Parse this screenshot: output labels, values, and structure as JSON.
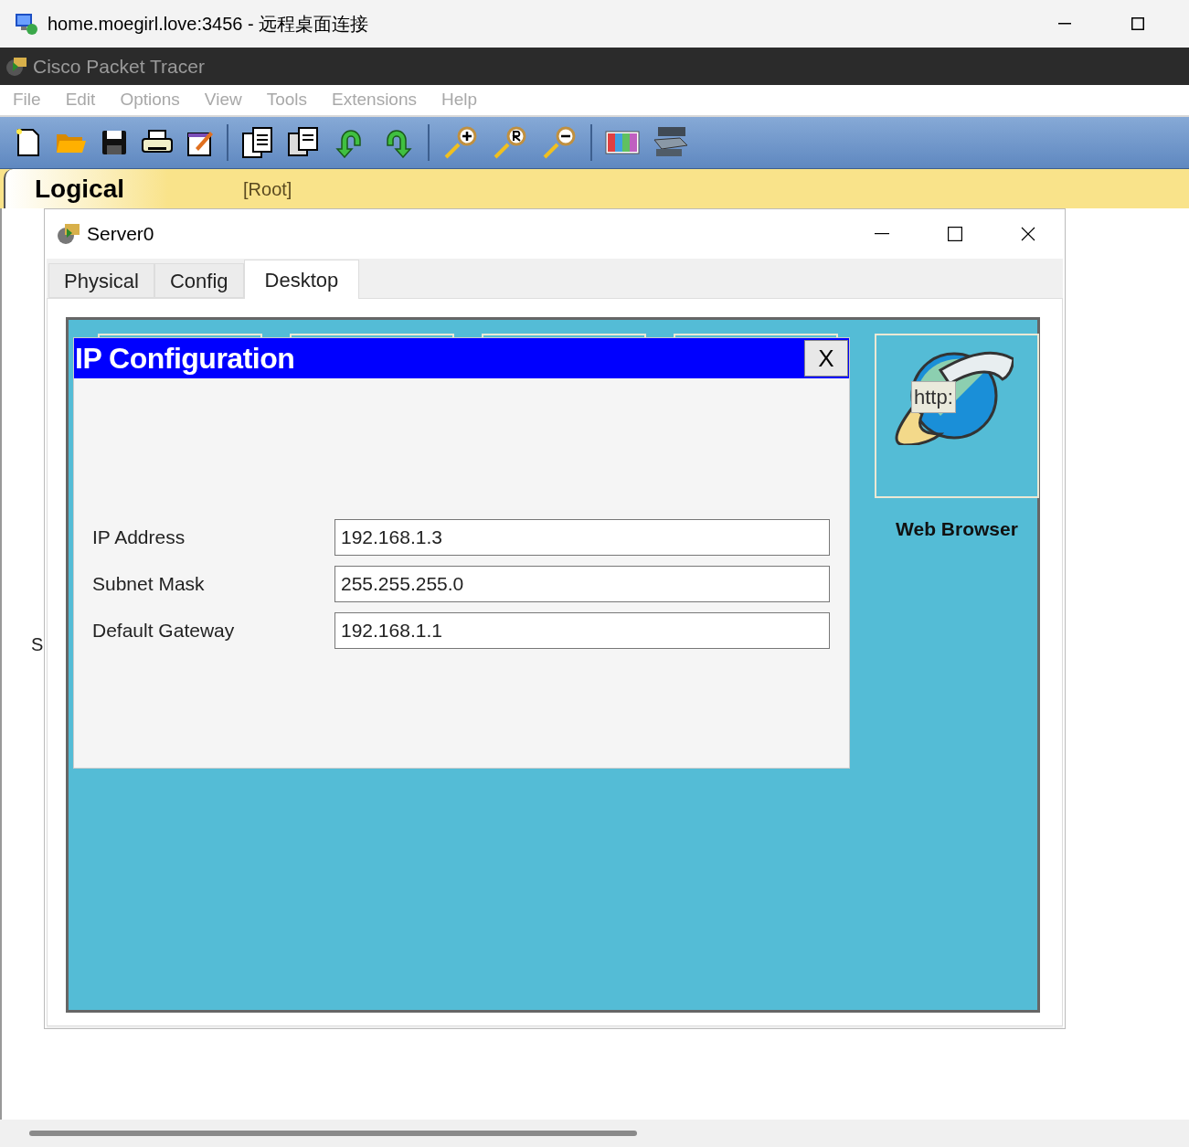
{
  "remote_window": {
    "title": "home.moegirl.love:3456 - 远程桌面连接"
  },
  "app": {
    "title": "Cisco Packet Tracer",
    "menu": [
      "File",
      "Edit",
      "Options",
      "View",
      "Tools",
      "Extensions",
      "Help"
    ],
    "workspace": {
      "tab": "Logical",
      "path": "[Root]"
    },
    "canvas_labels": [
      "S"
    ]
  },
  "device_window": {
    "title": "Server0",
    "tabs": [
      {
        "label": "Physical",
        "selected": false
      },
      {
        "label": "Config",
        "selected": false
      },
      {
        "label": "Desktop",
        "selected": true
      }
    ],
    "ip_configuration": {
      "title": "IP Configuration",
      "close": "X",
      "fields": [
        {
          "label": "IP Address",
          "value": "192.168.1.3"
        },
        {
          "label": "Subnet Mask",
          "value": "255.255.255.0"
        },
        {
          "label": "Default Gateway",
          "value": "192.168.1.1"
        }
      ]
    },
    "apps": [
      {
        "label": "Web Browser",
        "badge": "http:"
      }
    ]
  }
}
